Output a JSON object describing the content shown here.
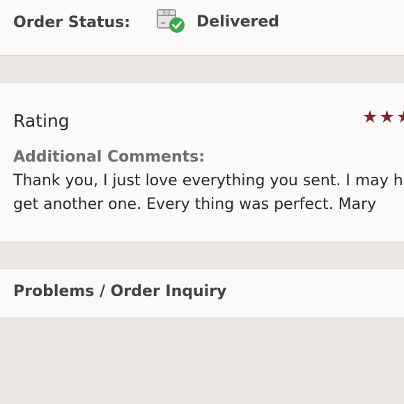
{
  "order_status": {
    "label": "Order Status:",
    "icon": "package-delivered-icon",
    "value": "Delivered"
  },
  "rating": {
    "title": "Rating",
    "stars_visible": 2,
    "star_color": "#8a2331",
    "comments_label": "Additional Comments:",
    "comments_lines": [
      "Thank you, I just love everything you sent. I may h",
      "get another one. Every thing was perfect. Mary"
    ]
  },
  "problems": {
    "label": "Problems / Order Inquiry"
  }
}
